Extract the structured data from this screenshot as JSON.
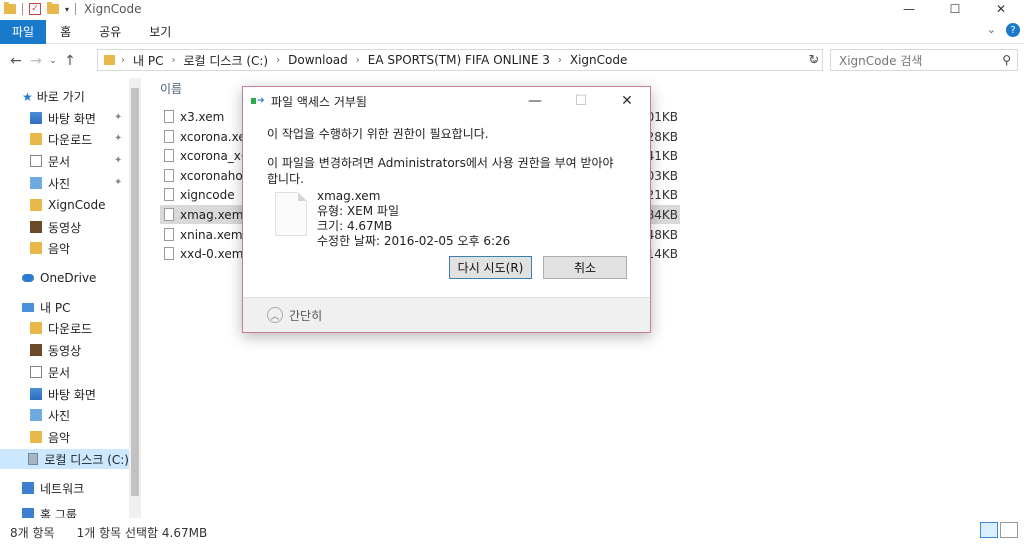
{
  "window": {
    "title": "XignCode",
    "minimize": "—",
    "maximize": "☐",
    "close": "✕"
  },
  "ribbon": {
    "tabs": [
      "파일",
      "홈",
      "공유",
      "보기"
    ],
    "expand": "⌄",
    "help": "?"
  },
  "address": {
    "back": "←",
    "forward": "→",
    "recent": "⌄",
    "up": "↑",
    "breadcrumb": [
      "내 PC",
      "로컬 디스크 (C:)",
      "Download",
      "EA SPORTS(TM) FIFA ONLINE 3",
      "XignCode"
    ],
    "refresh": "↻",
    "search_placeholder": "XignCode 검색"
  },
  "sidebar": {
    "quick_access": "바로 가기",
    "quick_items": [
      "바탕 화면",
      "다운로드",
      "문서",
      "사진",
      "XignCode",
      "동영상",
      "음악"
    ],
    "onedrive": "OneDrive",
    "this_pc": "내 PC",
    "pc_items": [
      "다운로드",
      "동영상",
      "문서",
      "바탕 화면",
      "사진",
      "음악",
      "로컬 디스크 (C:)"
    ],
    "network": "네트워크",
    "homegroup": "홈 그룹"
  },
  "file_list": {
    "header_name": "이름",
    "rows": [
      {
        "name": "x3.xem",
        "size": "01KB"
      },
      {
        "name": "xcorona.xem",
        "size": "28KB"
      },
      {
        "name": "xcorona_x64.",
        "size": "41KB"
      },
      {
        "name": "xcoronahost.",
        "size": "03KB"
      },
      {
        "name": "xigncode",
        "size": "21KB"
      },
      {
        "name": "xmag.xem",
        "size": "84KB"
      },
      {
        "name": "xnina.xem",
        "size": "48KB"
      },
      {
        "name": "xxd-0.xem",
        "size": "14KB"
      }
    ]
  },
  "status": {
    "count": "8개 항목",
    "selection": "1개 항목 선택함 4.67MB"
  },
  "dialog": {
    "title": "파일 액세스 거부됨",
    "message1": "이 작업을 수행하기 위한 권한이 필요합니다.",
    "message2": "이 파일을 변경하려면 Administrators에서 사용 권한을 부여 받아야 합니다.",
    "file_name": "xmag.xem",
    "file_type": "유형: XEM 파일",
    "file_size": "크기: 4.67MB",
    "file_modified": "수정한 날짜: 2016-02-05 오후 6:26",
    "retry": "다시 시도(R)",
    "cancel": "취소",
    "collapse": "간단히",
    "minimize": "—",
    "maximize": "☐",
    "close": "✕"
  }
}
